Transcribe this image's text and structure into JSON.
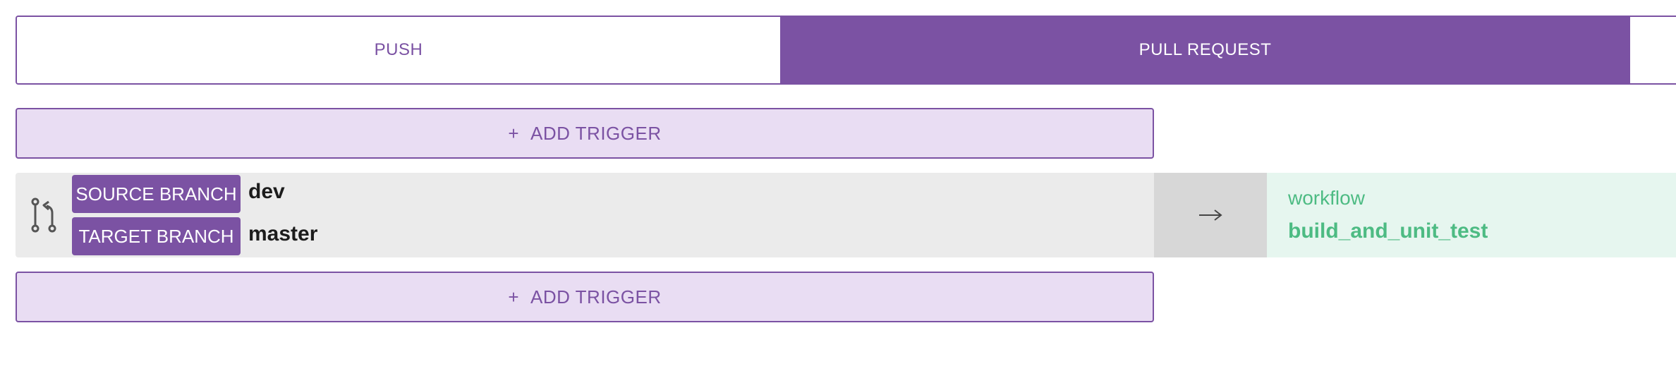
{
  "tabs": [
    {
      "label": "PUSH",
      "selected": false
    },
    {
      "label": "PULL REQUEST",
      "selected": true
    }
  ],
  "add_trigger": {
    "plus": "+",
    "label": "ADD TRIGGER"
  },
  "trigger": {
    "icon": "pull-request-icon",
    "source_label": "SOURCE BRANCH",
    "source_value": "dev",
    "target_label": "TARGET BRANCH",
    "target_value": "master",
    "arrow_icon": "arrow-right-icon",
    "workflow_label": "workflow",
    "workflow_name": "build_and_unit_test"
  },
  "colors": {
    "accent": "#7b52a3",
    "accent_light": "#e9ddf3",
    "success": "#4dbb83",
    "success_light": "#e6f6ef"
  }
}
